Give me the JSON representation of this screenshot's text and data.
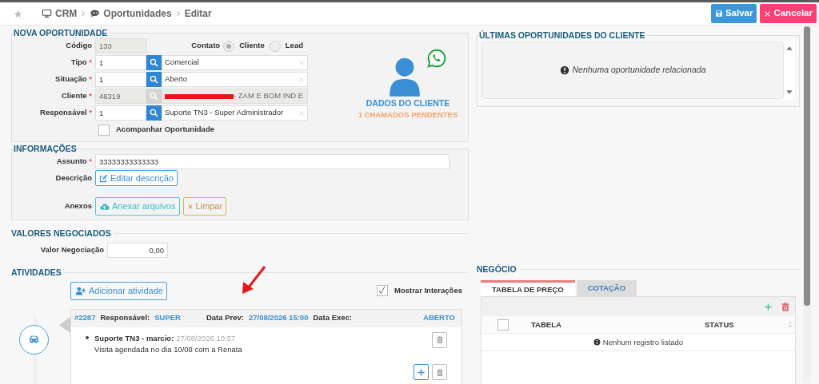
{
  "breadcrumb": [
    {
      "label": "CRM"
    },
    {
      "label": "Oportunidades"
    },
    {
      "label": "Editar"
    }
  ],
  "actions": [
    {
      "label": "Salvar",
      "kind": "save"
    },
    {
      "label": "Cancelar",
      "kind": "cancel"
    }
  ],
  "nova_oportunidade": {
    "title": "NOVA OPORTUNIDADE",
    "codigo": {
      "label": "Código",
      "value": "133"
    },
    "contato": {
      "label": "Contato",
      "options": [
        {
          "label": "Cliente",
          "selected": true
        },
        {
          "label": "Lead",
          "selected": false
        }
      ]
    },
    "lookups": [
      {
        "label": "Tipo",
        "mark": "*",
        "code": "1",
        "text": "Comercial",
        "disabled": false,
        "redacted": false
      },
      {
        "label": "Situação",
        "mark": "*",
        "code": "1",
        "text": "Aberto",
        "disabled": false,
        "redacted": false
      },
      {
        "label": "Cliente",
        "mark": "*",
        "code": "48319",
        "text": "- ZAM E BOM IND E",
        "disabled": true,
        "redacted": true
      },
      {
        "label": "Responsável",
        "mark": "*",
        "code": "1",
        "text": "Suporte TN3 - Super Administrador",
        "disabled": false,
        "redacted": false
      }
    ],
    "acompanhar": {
      "label": "Acompanhar Oportunidade",
      "checked": false
    },
    "client_card": {
      "title": "DADOS DO CLIENTE",
      "subtitle": "1 CHAMADOS PENDENTES"
    }
  },
  "informacoes": {
    "title": "INFORMAÇÕES",
    "assunto": {
      "label": "Assunto",
      "mark": "*",
      "value": "33333333333333"
    },
    "descricao": {
      "label": "Descrição",
      "button": "Editar descrição"
    },
    "anexos": {
      "label": "Anexos",
      "buttons": [
        {
          "label": "Anexar arquivos",
          "kind": "attach"
        },
        {
          "label": "Limpar",
          "kind": "clear"
        }
      ]
    }
  },
  "valores": {
    "title": "VALORES NEGOCIADOS",
    "label": "Valor Negociação",
    "value": "0,00"
  },
  "atividades": {
    "title": "ATIVIDADES",
    "add_button": "Adicionar atividade",
    "show_interactions": {
      "label": "Mostrar Interações",
      "checked": true
    },
    "items": [
      {
        "id": "#2287",
        "responsavel_label": "Responsável:",
        "responsavel": "SUPER",
        "prev_label": "Data Prev:",
        "prev": "27/08/2026 15:00",
        "exec_label": "Data Exec:",
        "status": "ABERTO",
        "interactions": [
          {
            "author": "Suporte TN3 - marcio:",
            "time": "27/08/2026 10:57",
            "text": "Visita agendada no dia 10/08 com a Renata"
          }
        ]
      }
    ]
  },
  "ultimas": {
    "title": "ÚLTIMAS OPORTUNIDADES DO CLIENTE",
    "empty": "Nenhuma oportunidade relacionada"
  },
  "negocio": {
    "title": "NEGÓCIO",
    "tabs": [
      {
        "label": "TABELA DE PREÇO",
        "selected": true
      },
      {
        "label": "COTAÇÃO",
        "selected": false
      }
    ],
    "table": {
      "select_all": {
        "checked": false
      },
      "columns": [
        "TABELA",
        "STATUS"
      ],
      "empty": "Nenhum registro listado"
    }
  }
}
